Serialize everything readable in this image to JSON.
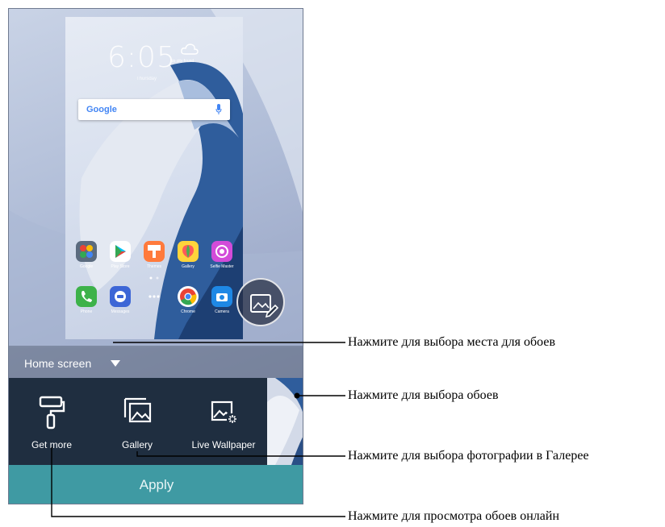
{
  "preview": {
    "clock": "6:05",
    "weather": "No city found",
    "date": "Thursday",
    "search_logo": "Google",
    "apps_row1": [
      {
        "label": "Google",
        "color": "#5b6b7f",
        "icon": "folder-icon"
      },
      {
        "label": "Play Store",
        "color": "#ffffff",
        "icon": "play-store-icon"
      },
      {
        "label": "Themes",
        "color": "#ff7a3c",
        "icon": "themes-icon"
      },
      {
        "label": "Gallery",
        "color": "#ffd43b",
        "icon": "gallery-balloon-icon"
      },
      {
        "label": "Selfie Master",
        "color": "#d24bd9",
        "icon": "selfie-master-icon"
      }
    ],
    "apps_row2": [
      {
        "label": "Phone",
        "color": "#3db24a",
        "icon": "phone-icon"
      },
      {
        "label": "Messages",
        "color": "#3d66d6",
        "icon": "messages-icon"
      },
      {
        "label": "",
        "color": "transparent",
        "icon": "app-drawer-icon"
      },
      {
        "label": "Chrome",
        "color": "#ffffff",
        "icon": "chrome-icon"
      },
      {
        "label": "Camera",
        "color": "#1e88e5",
        "icon": "camera-icon"
      }
    ]
  },
  "mode_selector": {
    "label": "Home screen",
    "icon": "caret-down-icon"
  },
  "options": [
    {
      "label": "Get more",
      "icon": "paint-roller-icon"
    },
    {
      "label": "Gallery",
      "icon": "gallery-icon"
    },
    {
      "label": "Live Wallpaper",
      "icon": "live-wallpaper-icon"
    }
  ],
  "apply_label": "Apply",
  "callouts": {
    "location": "Нажмите для выбора места для обоев",
    "wallpaper": "Нажмите для выбора обоев",
    "gallery": "Нажмите для выбора фотографии в Галерее",
    "online": "Нажмите для просмотра обоев онлайн"
  }
}
